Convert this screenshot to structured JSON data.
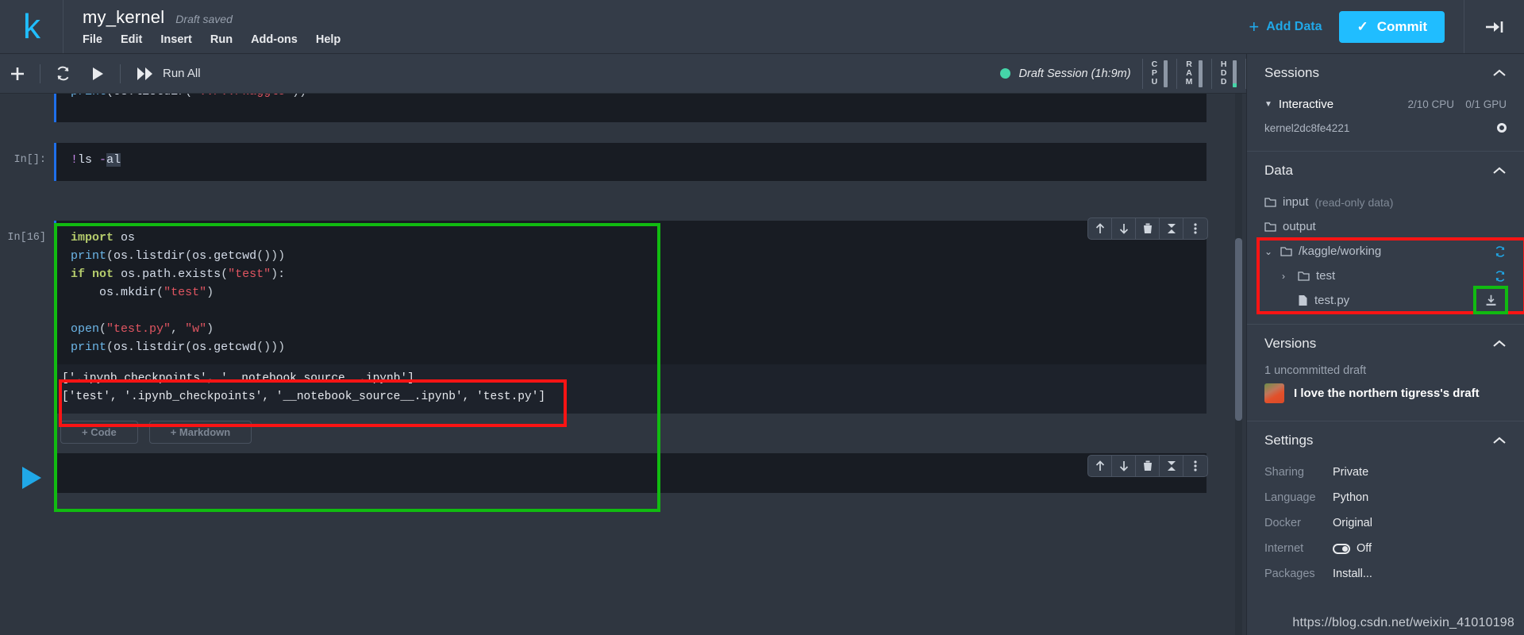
{
  "header": {
    "logo": "k",
    "kernel_title": "my_kernel",
    "draft_status": "Draft saved",
    "menu": [
      "File",
      "Edit",
      "Insert",
      "Run",
      "Add-ons",
      "Help"
    ],
    "add_data_label": "Add Data",
    "add_data_plus": "+",
    "commit_label": "Commit",
    "commit_check": "✓"
  },
  "toolbar": {
    "add_cell_icon": "plus-icon",
    "restart_icon": "refresh-icon",
    "run_icon": "play-icon",
    "run_all_label": "Run All",
    "session_text": "Draft Session (1h:9m)",
    "meters": [
      {
        "letters": [
          "C",
          "P",
          "U"
        ],
        "fill_pct": 0
      },
      {
        "letters": [
          "R",
          "A",
          "M"
        ],
        "fill_pct": 0
      },
      {
        "letters": [
          "H",
          "D",
          "D"
        ],
        "fill_pct": 14
      }
    ]
  },
  "notebook": {
    "cut_cell": {
      "line_html": "<span class=\"k-fn\">print</span><span class=\"k-op\">(</span><span class=\"k-var\">os</span><span class=\"k-op\">.</span><span class=\"k-var\">listdir</span><span class=\"k-op\">(</span><span class=\"k-str\">'../../kaggle'</span><span class=\"k-op\">))</span>"
    },
    "cell_ls": {
      "label": "In[]:",
      "line_html": "<span class=\"k-bang\">!</span><span class=\"k-var\">ls</span> <span class=\"k-bang\">-</span><span class=\"sel-hl k-var\">al</span>"
    },
    "cell_main": {
      "label": "In[16]",
      "lines_html": [
        "<span class=\"k-key\">import</span> <span class=\"k-var\">os</span>",
        "<span class=\"k-fn\">print</span><span class=\"k-op\">(</span><span class=\"k-var\">os</span><span class=\"k-op\">.</span><span class=\"k-var\">listdir</span><span class=\"k-op\">(</span><span class=\"k-var\">os</span><span class=\"k-op\">.</span><span class=\"k-var\">getcwd</span><span class=\"k-op\">()))</span>",
        "<span class=\"k-key\">if</span> <span class=\"k-key\">not</span> <span class=\"k-var\">os</span><span class=\"k-op\">.</span><span class=\"k-var\">path</span><span class=\"k-op\">.</span><span class=\"k-var\">exists</span><span class=\"k-op\">(</span><span class=\"k-str\">\"test\"</span><span class=\"k-op\">):</span>",
        "    <span class=\"k-var\">os</span><span class=\"k-op\">.</span><span class=\"k-var\">mkdir</span><span class=\"k-op\">(</span><span class=\"k-str\">\"test\"</span><span class=\"k-op\">)</span>",
        "",
        "<span class=\"k-fn\">open</span><span class=\"k-op\">(</span><span class=\"k-str\">\"test.py\"</span><span class=\"k-op\">, </span><span class=\"k-str\">\"w\"</span><span class=\"k-op\">)</span>",
        "<span class=\"k-fn\">print</span><span class=\"k-op\">(</span><span class=\"k-var\">os</span><span class=\"k-op\">.</span><span class=\"k-var\">listdir</span><span class=\"k-op\">(</span><span class=\"k-var\">os</span><span class=\"k-op\">.</span><span class=\"k-var\">getcwd</span><span class=\"k-op\">()))</span>"
      ],
      "output_lines": [
        "['.ipynb_checkpoints', '__notebook_source__.ipynb']",
        "['test', '.ipynb_checkpoints', '__notebook_source__.ipynb', 'test.py']"
      ]
    },
    "add_code_label": "+ Code",
    "add_markdown_label": "+ Markdown",
    "cell_tool_icons": [
      "move-up-icon",
      "move-down-icon",
      "delete-icon",
      "collapse-icon",
      "more-options-icon"
    ]
  },
  "sidebar": {
    "sessions": {
      "title": "Sessions",
      "session_name": "Interactive",
      "cpu": "2/10 CPU",
      "gpu": "0/1 GPU",
      "kernel_id": "kernel2dc8fe4221"
    },
    "data": {
      "title": "Data",
      "input_label": "input",
      "input_note": "(read-only data)",
      "output_label": "output",
      "working_label": "/kaggle/working",
      "test_folder_label": "test",
      "test_file_label": "test.py"
    },
    "versions": {
      "title": "Versions",
      "uncommitted": "1 uncommitted draft",
      "draft_title": "I love the northern tigress's draft"
    },
    "settings": {
      "title": "Settings",
      "rows": [
        {
          "key": "Sharing",
          "value": "Private"
        },
        {
          "key": "Language",
          "value": "Python"
        },
        {
          "key": "Docker",
          "value": "Original"
        },
        {
          "key": "Internet",
          "value": "Off"
        },
        {
          "key": "Packages",
          "value": "Install..."
        }
      ]
    }
  },
  "watermark": "https://blog.csdn.net/weixin_41010198",
  "colors": {
    "accent": "#20bdff",
    "annotation_green": "#11bb11",
    "annotation_red": "#fa1414",
    "status_green": "#45d4a8"
  }
}
